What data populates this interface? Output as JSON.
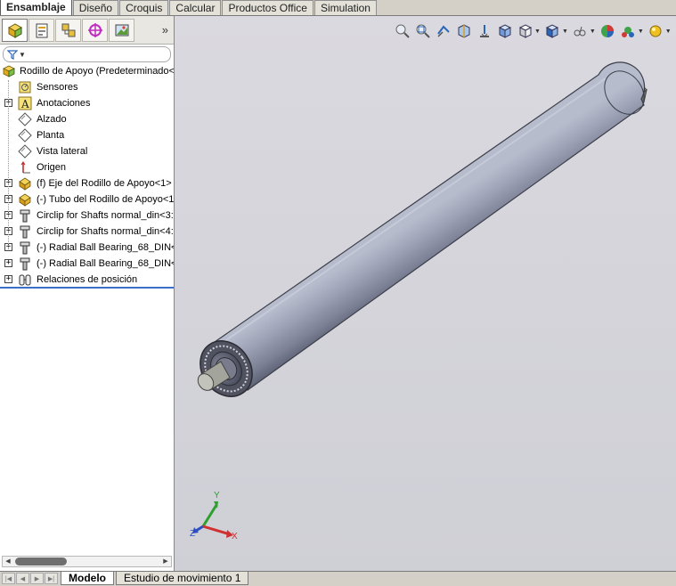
{
  "command_tabs": [
    "Ensamblaje",
    "Diseño",
    "Croquis",
    "Calcular",
    "Productos Office",
    "Simulation"
  ],
  "panel_tabs": [
    "feature-manager",
    "property-manager",
    "configuration-manager",
    "dimxpert-manager",
    "display-manager"
  ],
  "tree": {
    "root": "Rodillo de Apoyo  (Predeterminado<",
    "items": [
      {
        "label": "Sensores",
        "icon": "sensor-icon",
        "expandable": false
      },
      {
        "label": "Anotaciones",
        "icon": "annotation-icon",
        "expandable": true
      },
      {
        "label": "Alzado",
        "icon": "plane-icon",
        "expandable": false
      },
      {
        "label": "Planta",
        "icon": "plane-icon",
        "expandable": false
      },
      {
        "label": "Vista lateral",
        "icon": "plane-icon",
        "expandable": false
      },
      {
        "label": "Origen",
        "icon": "origin-icon",
        "expandable": false
      },
      {
        "label": "(f) Eje del Rodillo de Apoyo<1>",
        "icon": "part-icon",
        "expandable": true
      },
      {
        "label": "(-) Tubo del Rodillo de Apoyo<1",
        "icon": "part-icon",
        "expandable": true
      },
      {
        "label": "Circlip for Shafts normal_din<3:",
        "icon": "toolbox-part-icon",
        "expandable": true
      },
      {
        "label": "Circlip for Shafts normal_din<4:",
        "icon": "toolbox-part-icon",
        "expandable": true
      },
      {
        "label": "(-) Radial Ball Bearing_68_DIN<",
        "icon": "toolbox-part-icon",
        "expandable": true
      },
      {
        "label": "(-) Radial Ball Bearing_68_DIN<",
        "icon": "toolbox-part-icon",
        "expandable": true
      },
      {
        "label": "Relaciones de posición",
        "icon": "mates-icon",
        "expandable": true
      }
    ]
  },
  "triad": {
    "x": "X",
    "y": "Y",
    "z": "Z"
  },
  "bottom_tabs": [
    "Modelo",
    "Estudio de movimiento 1"
  ],
  "colors": {
    "rollback_bar": "#3c6fc7",
    "viewport_bg": "#d6d6dc",
    "roller": "#8d91a6"
  }
}
